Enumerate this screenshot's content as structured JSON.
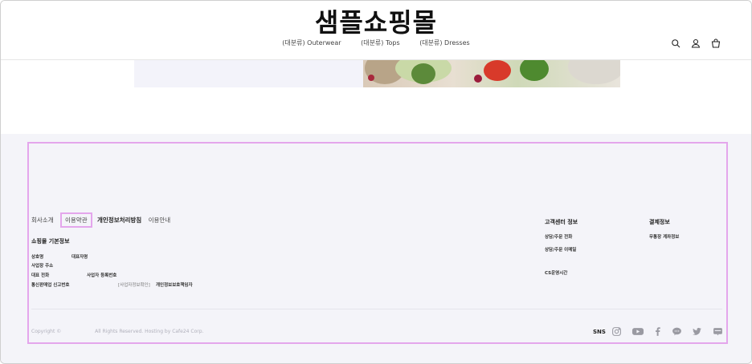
{
  "header": {
    "logo": "샘플쇼핑몰",
    "nav": [
      "(대분류) Outerwear",
      "(대분류) Tops",
      "(대분류) Dresses"
    ],
    "icons": [
      "search-icon",
      "user-icon",
      "shopping-bag-icon"
    ]
  },
  "footer": {
    "links": {
      "company": "회사소개",
      "terms": "이용약관",
      "privacy": "개인정보처리방침",
      "guide": "이용안내"
    },
    "shop_info": {
      "title": "쇼핑몰 기본정보",
      "company_name": "상호명",
      "ceo": "대표자명",
      "address": "사업장 주소",
      "phone": "대표 전화",
      "biz_number": "사업자 등록번호",
      "ecommerce_number": "통신판매업 신고번호",
      "biz_check": "[사업자정보확인]",
      "privacy_officer": "개인정보보호책임자"
    },
    "cs": {
      "title": "고객센터 정보",
      "phone": "상담/주문 전화",
      "email": "상담/주문 이메일",
      "hours": "CS운영시간"
    },
    "payment": {
      "title": "결제정보",
      "bank": "무통장 계좌정보"
    },
    "copyright": {
      "text": "Copyright ©",
      "rights": "All Rights Reserved. Hosting by Cafe24 Corp."
    },
    "sns": {
      "label": "SNS",
      "icons": [
        "instagram-icon",
        "youtube-icon",
        "facebook-icon",
        "kakaotalk-icon",
        "twitter-icon",
        "blog-icon"
      ]
    }
  },
  "colors": {
    "highlight": "#e4a6ec",
    "footer_bg": "#f4f4f9"
  }
}
